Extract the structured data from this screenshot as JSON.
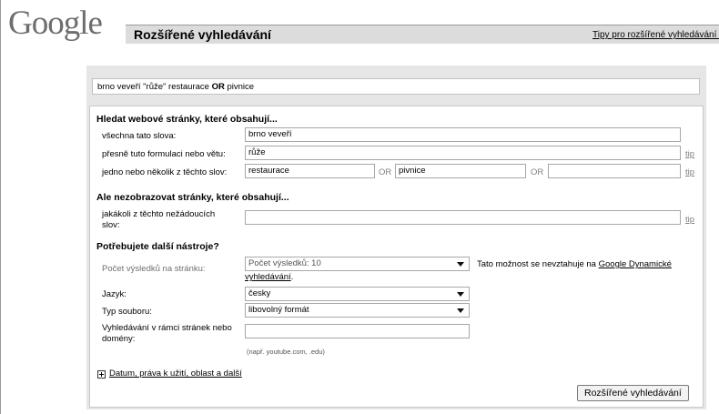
{
  "header": {
    "logo_text": "Google",
    "page_title": "Rozšířené vyhledávání",
    "tips_link": "Tipy pro rozšířené vyhledávání |"
  },
  "query_preview": {
    "before": "brno veveří \"růže\" restaurace ",
    "operator": "OR",
    "after": " pivnice"
  },
  "find": {
    "heading": "Hledat webové stránky, které obsahují...",
    "all_words_label": "všechna tato slova:",
    "all_words_value": "brno veveří",
    "exact_phrase_label": "přesně tuto formulaci nebo větu:",
    "exact_phrase_value": "růže",
    "any_words_label": "jedno nebo několik z těchto slov:",
    "any_words_values": [
      "restaurace",
      "pivnice",
      ""
    ],
    "or_label": "OR",
    "tip_label": "tip"
  },
  "exclude": {
    "heading": "Ale nezobrazovat stránky, které obsahují...",
    "label_line1": "jakákoli z těchto nežádoucích",
    "label_line2": "slov:",
    "value": "",
    "tip_label": "tip"
  },
  "tools": {
    "heading": "Potřebujete další nástroje?",
    "results_label": "Počet výsledků na stránku:",
    "results_value": "Počet výsledků: 10",
    "results_note_text": "Tato možnost se nevztahuje na ",
    "results_note_link1": "Google Dynamické",
    "results_note_link2": "vyhledávání",
    "results_note_end": ".",
    "language_label": "Jazyk:",
    "language_value": "česky",
    "filetype_label": "Typ souboru:",
    "filetype_value": "libovolný formát",
    "site_label_line1": "Vyhledávání v rámci stránek nebo",
    "site_label_line2": "domény:",
    "site_value": "",
    "site_hint": "(např. youtube.com, .edu)"
  },
  "more_link": "Datum, práva k užití, oblast a další",
  "submit_button": "Rozšířené vyhledávání",
  "icons": {
    "dropdown": "chevron-down-icon",
    "expand": "plus-icon"
  },
  "colors": {
    "header_bar": "#dcdcdc",
    "outer_box": "#e6e6e6",
    "muted_text": "#808080"
  }
}
